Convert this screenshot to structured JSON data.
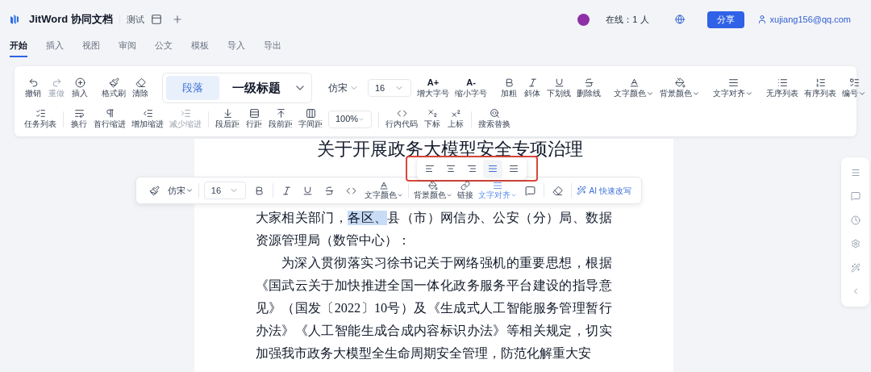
{
  "header": {
    "app_name": "JitWord 协同文档",
    "doc_name": "测试",
    "online": "在线：1 人",
    "share": "分享",
    "user": "xujiang156@qq.com"
  },
  "tabs": [
    {
      "label": "开始",
      "selected": true
    },
    {
      "label": "插入",
      "selected": false
    },
    {
      "label": "视图",
      "selected": false
    },
    {
      "label": "审阅",
      "selected": false
    },
    {
      "label": "公文",
      "selected": false
    },
    {
      "label": "模板",
      "selected": false
    },
    {
      "label": "导入",
      "selected": false
    },
    {
      "label": "导出",
      "selected": false
    }
  ],
  "toolbar": {
    "rows": [
      [
        [
          {
            "kind": "button",
            "label": "撤销",
            "disabled": false
          },
          {
            "kind": "button",
            "label": "重做",
            "disabled": true
          },
          {
            "kind": "button",
            "label": "插入",
            "disabled": false
          }
        ],
        [
          {
            "kind": "button",
            "label": "格式刷",
            "disabled": false
          },
          {
            "kind": "button",
            "label": "清除",
            "disabled": false
          }
        ],
        [
          {
            "kind": "style-select",
            "options": [
              {
                "label": "段落",
                "selected": true
              },
              {
                "label": "一级标题",
                "selected": false
              }
            ]
          }
        ],
        [
          {
            "kind": "text-menu",
            "label": "仿宋"
          },
          {
            "kind": "select",
            "value": "16"
          },
          {
            "kind": "glyph-button",
            "glyph": "A+",
            "label": "增大字号",
            "disabled": false
          },
          {
            "kind": "glyph-button",
            "glyph": "A-",
            "label": "缩小字号",
            "disabled": false
          }
        ],
        [
          {
            "kind": "button",
            "label": "加粗",
            "disabled": false
          },
          {
            "kind": "button",
            "label": "斜体",
            "disabled": false
          },
          {
            "kind": "button",
            "label": "下划线",
            "disabled": false
          },
          {
            "kind": "button",
            "label": "删除线",
            "disabled": false
          }
        ],
        [
          {
            "kind": "menu-button",
            "label": "文字颜色",
            "disabled": false
          },
          {
            "kind": "menu-button",
            "label": "背景颜色",
            "disabled": false
          }
        ],
        [
          {
            "kind": "menu-button",
            "label": "文字对齐",
            "disabled": false
          }
        ],
        [
          {
            "kind": "button",
            "label": "无序列表",
            "disabled": false
          },
          {
            "kind": "button",
            "label": "有序列表",
            "disabled": false
          },
          {
            "kind": "menu-button",
            "label": "编号",
            "disabled": false
          }
        ]
      ],
      [
        [
          {
            "kind": "button",
            "label": "任务列表",
            "disabled": false
          }
        ],
        [
          {
            "kind": "button",
            "label": "换行",
            "disabled": false
          },
          {
            "kind": "button",
            "label": "首行缩进",
            "disabled": false
          },
          {
            "kind": "button",
            "label": "增加缩进",
            "disabled": false
          },
          {
            "kind": "button",
            "label": "减少缩进",
            "disabled": true
          }
        ],
        [
          {
            "kind": "button",
            "label": "段后距",
            "disabled": false
          },
          {
            "kind": "button",
            "label": "行距",
            "disabled": false
          },
          {
            "kind": "button",
            "label": "段前距",
            "disabled": false
          },
          {
            "kind": "button",
            "label": "字间距",
            "disabled": false
          },
          {
            "kind": "select",
            "value": "100%"
          }
        ],
        [
          {
            "kind": "button",
            "label": "行内代码",
            "disabled": false
          },
          {
            "kind": "button",
            "label": "下标",
            "disabled": false
          },
          {
            "kind": "button",
            "label": "上标",
            "disabled": false
          }
        ],
        [
          {
            "kind": "button",
            "label": "搜索替换",
            "disabled": false
          }
        ]
      ]
    ]
  },
  "document": {
    "title": "关于开展政务大模型安全专项治理",
    "paragraphs": [
      {
        "indent": false,
        "segments": [
          {
            "text": "大家相关部门，",
            "highlighted": false
          },
          {
            "text": "各区、",
            "highlighted": true
          },
          {
            "text": "县（市）网信办、公安（分）局、数据资源管理局（数管中心）：",
            "highlighted": false
          }
        ]
      },
      {
        "indent": true,
        "segments": [
          {
            "text": "为深入贯彻落实习徐书记关于网络强机的重要思想，根据《国武云关于加快推进全国一体化政务服务平台建设的指导意见》（国发〔2022〕10号）及《生成式人工智能服务管理暂行办法》《人工智能生成合成内容标识办法》等相关规定，切实加强我市政务大模型全生命周期安全管理，防范化解重大安",
            "highlighted": false
          }
        ]
      }
    ]
  },
  "bubble_toolbar": {
    "items": [
      {
        "kind": "icon",
        "active": false
      },
      {
        "kind": "text-menu",
        "label": "仿宋",
        "active": false
      },
      {
        "kind": "select",
        "value": "16",
        "active": false
      },
      {
        "kind": "icon",
        "active": false
      },
      {
        "kind": "icon",
        "active": false
      },
      {
        "kind": "icon",
        "active": false
      },
      {
        "kind": "icon",
        "active": false
      },
      {
        "kind": "icon",
        "active": false
      },
      {
        "kind": "menu-button",
        "label": "文字颜色",
        "active": false
      },
      {
        "kind": "menu-button",
        "label": "背景颜色",
        "active": false
      },
      {
        "kind": "button",
        "label": "链接",
        "active": false
      },
      {
        "kind": "menu-button",
        "label": "文字对齐",
        "active": true
      },
      {
        "kind": "icon",
        "active": false
      },
      {
        "kind": "icon",
        "active": false
      },
      {
        "kind": "ai-button",
        "label": "AI 快速改写",
        "active": false
      }
    ]
  },
  "align_menu": {
    "highlighted": true,
    "options": [
      {
        "selected": false
      },
      {
        "selected": false
      },
      {
        "selected": false
      },
      {
        "selected": true
      },
      {
        "selected": false
      }
    ]
  }
}
